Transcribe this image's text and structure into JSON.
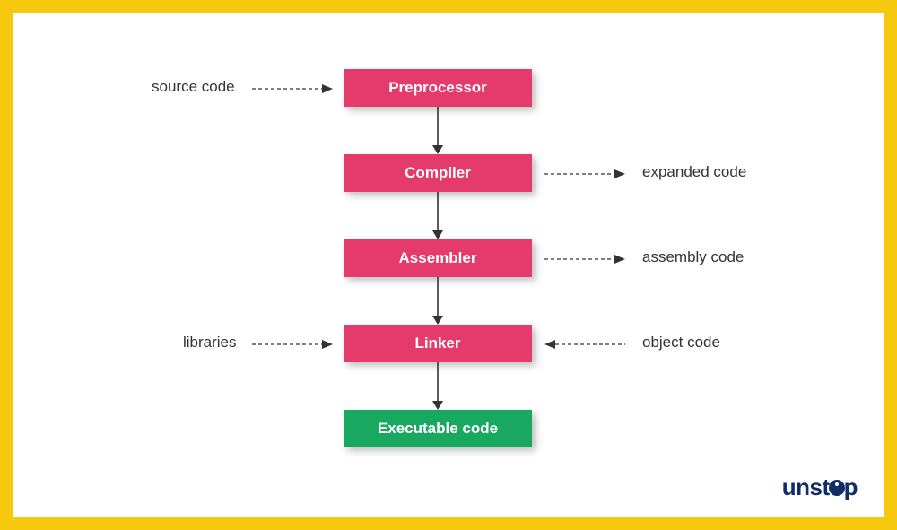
{
  "stages": {
    "preprocessor": "Preprocessor",
    "compiler": "Compiler",
    "assembler": "Assembler",
    "linker": "Linker",
    "executable": "Executable code"
  },
  "annotations": {
    "source_code": "source code",
    "expanded_code": "expanded code",
    "assembly_code": "assembly code",
    "libraries": "libraries",
    "object_code": "object code"
  },
  "logo": {
    "prefix": "unst",
    "suffix": "p"
  },
  "colors": {
    "border": "#f6c90e",
    "stage": "#e43b6c",
    "final": "#18a860",
    "text": "#333333",
    "logo": "#0f2e66"
  }
}
